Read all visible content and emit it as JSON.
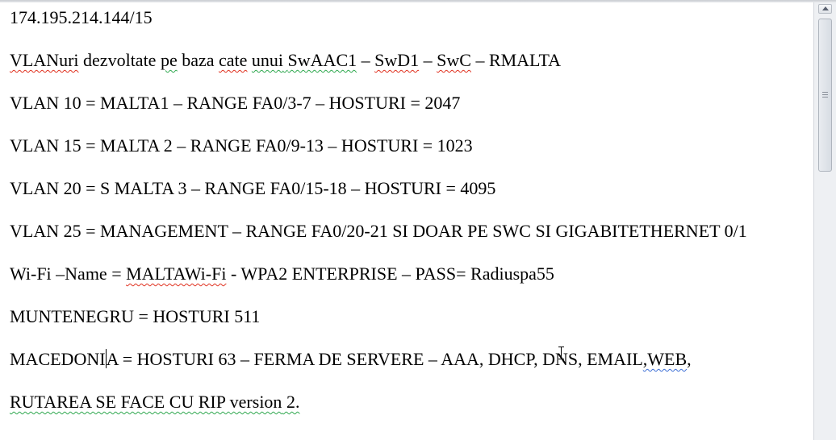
{
  "document": {
    "line0": "174.195.214.144/15",
    "line1": {
      "a": "VLANuri",
      "b": " dezvoltate ",
      "c": "pe",
      "d": " baza ",
      "e": "cate",
      "f": " ",
      "g": "unui",
      "h": "  ",
      "i": "SwAAC1",
      "j": " – ",
      "k": "SwD1",
      "l": " – ",
      "m": "SwC",
      "n": " – RMALTA"
    },
    "line2": "VLAN 10 = MALTA1 – RANGE FA0/3-7 – HOSTURI = 2047",
    "line3": "VLAN 15 = MALTA 2 – RANGE FA0/9-13 – HOSTURI = 1023",
    "line4": "VLAN 20 = S MALTA 3 – RANGE FA0/15-18 – HOSTURI = 4095",
    "line5": "VLAN 25 = MANAGEMENT – RANGE FA0/20-21 SI DOAR PE SWC SI GIGABITETHERNET 0/1",
    "line6": {
      "a": "Wi-Fi –Name = ",
      "b": "MALTAWi-Fi",
      "c": " - WPA2 ENTERPRISE – PASS= ",
      "d": "Radiuspa55"
    },
    "line7": "MUNTENEGRU = HOSTURI 511",
    "line8": {
      "a": "MACEDONI",
      "b": "A = HOSTURI 63 – FERMA DE SERVERE – AAA, DHCP, DNS, EMAIL",
      "c": ",WEB",
      "d": ","
    },
    "line9": {
      "a": "RUTAREA SE FACE CU RIP ",
      "b": "version",
      "c": " 2."
    }
  },
  "colors": {
    "spelling": "#e0301e",
    "grammar": "#2fa84f",
    "context": "#3d6fd6"
  }
}
